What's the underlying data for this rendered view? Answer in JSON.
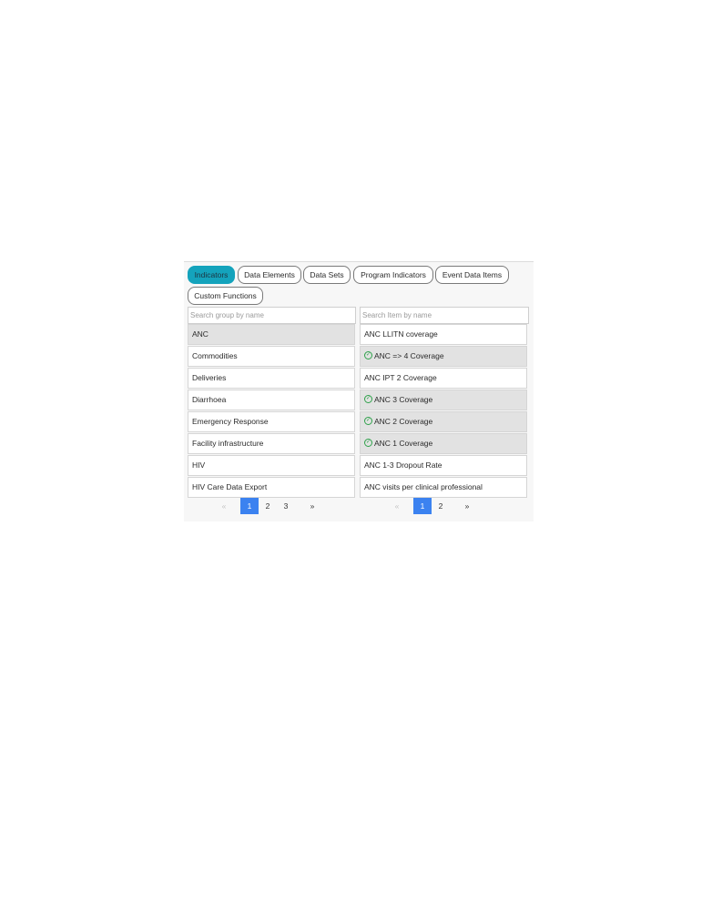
{
  "tabs": [
    {
      "label": "Indicators",
      "active": true
    },
    {
      "label": "Data Elements",
      "active": false
    },
    {
      "label": "Data Sets",
      "active": false
    },
    {
      "label": "Program Indicators",
      "active": false
    },
    {
      "label": "Event Data Items",
      "active": false
    },
    {
      "label": "Custom Functions",
      "active": false
    }
  ],
  "groups": {
    "search_placeholder": "Search group by name",
    "items": [
      {
        "label": "ANC",
        "selected": true
      },
      {
        "label": "Commodities",
        "selected": false
      },
      {
        "label": "Deliveries",
        "selected": false
      },
      {
        "label": "Diarrhoea",
        "selected": false
      },
      {
        "label": "Emergency Response",
        "selected": false
      },
      {
        "label": "Facility infrastructure",
        "selected": false
      },
      {
        "label": "HIV",
        "selected": false
      },
      {
        "label": "HIV Care Data Export",
        "selected": false
      }
    ],
    "pagination": {
      "prev": "«",
      "pages": [
        "1",
        "2",
        "3"
      ],
      "current": "1",
      "next": "»"
    }
  },
  "items": {
    "search_placeholder": "Search Item by name",
    "items": [
      {
        "label": "ANC LLITN coverage",
        "selected": false
      },
      {
        "label": "ANC => 4 Coverage",
        "selected": true
      },
      {
        "label": "ANC IPT 2 Coverage",
        "selected": false
      },
      {
        "label": "ANC 3 Coverage",
        "selected": true
      },
      {
        "label": "ANC 2 Coverage",
        "selected": true
      },
      {
        "label": "ANC 1 Coverage",
        "selected": true
      },
      {
        "label": "ANC 1-3 Dropout Rate",
        "selected": false
      },
      {
        "label": "ANC visits per clinical professional",
        "selected": false
      }
    ],
    "pagination": {
      "prev": "«",
      "pages": [
        "1",
        "2"
      ],
      "current": "1",
      "next": "»"
    }
  },
  "icons": {
    "selected_marker": "check-circle-icon"
  },
  "colors": {
    "active_tab": "#14a3bc",
    "active_page": "#3b82f0",
    "check": "#2ea14a",
    "selected_row": "#e2e2e2"
  }
}
